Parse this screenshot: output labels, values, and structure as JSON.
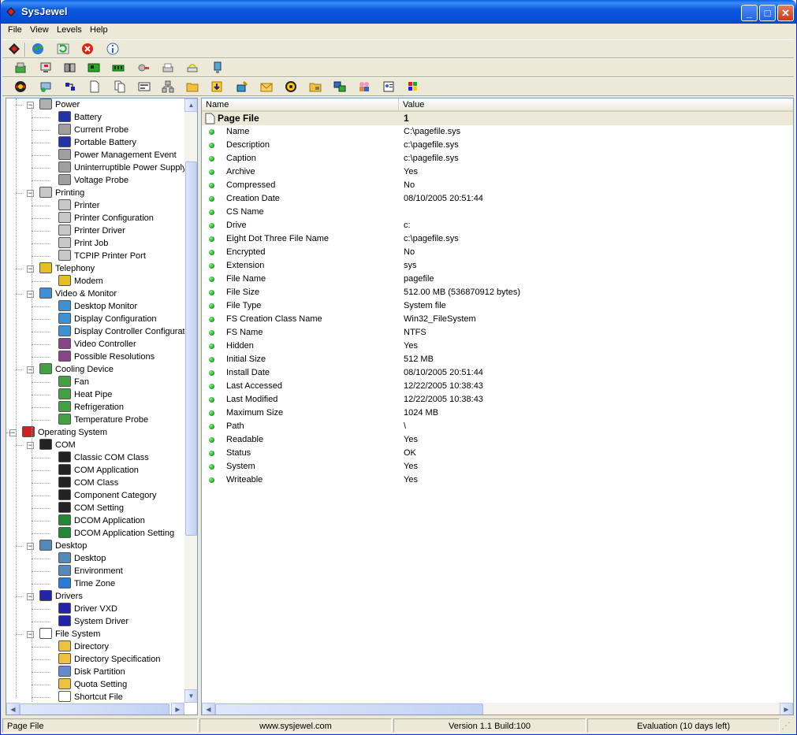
{
  "window": {
    "title": "SysJewel",
    "controls": {
      "minimize": "_",
      "maximize": "□",
      "close": "✕"
    }
  },
  "menu": [
    "File",
    "View",
    "Levels",
    "Help"
  ],
  "tree": [
    {
      "label": "Power",
      "level": 1,
      "icon": "power-icon",
      "expanded": true
    },
    {
      "label": "Battery",
      "level": 2,
      "icon": "battery-icon"
    },
    {
      "label": "Current Probe",
      "level": 2,
      "icon": "probe-icon"
    },
    {
      "label": "Portable Battery",
      "level": 2,
      "icon": "battery-icon"
    },
    {
      "label": "Power Management Event",
      "level": 2,
      "icon": "probe-icon"
    },
    {
      "label": "Uninterruptible Power Supply",
      "level": 2,
      "icon": "probe-icon"
    },
    {
      "label": "Voltage Probe",
      "level": 2,
      "icon": "probe-icon"
    },
    {
      "label": "Printing",
      "level": 1,
      "icon": "printer-icon",
      "expanded": true
    },
    {
      "label": "Printer",
      "level": 2,
      "icon": "printer-icon"
    },
    {
      "label": "Printer Configuration",
      "level": 2,
      "icon": "printer-icon"
    },
    {
      "label": "Printer Driver",
      "level": 2,
      "icon": "printer-icon"
    },
    {
      "label": "Print Job",
      "level": 2,
      "icon": "printer-icon"
    },
    {
      "label": "TCPIP Printer Port",
      "level": 2,
      "icon": "printer-icon"
    },
    {
      "label": "Telephony",
      "level": 1,
      "icon": "modem-icon",
      "expanded": true
    },
    {
      "label": "Modem",
      "level": 2,
      "icon": "modem-icon"
    },
    {
      "label": "Video & Monitor",
      "level": 1,
      "icon": "monitor-icon",
      "expanded": true
    },
    {
      "label": "Desktop Monitor",
      "level": 2,
      "icon": "monitor-icon"
    },
    {
      "label": "Display Configuration",
      "level": 2,
      "icon": "monitor-icon"
    },
    {
      "label": "Display Controller Configuratio",
      "level": 2,
      "icon": "monitor-icon"
    },
    {
      "label": "Video Controller",
      "level": 2,
      "icon": "video-card-icon"
    },
    {
      "label": "Possible Resolutions",
      "level": 2,
      "icon": "video-card-icon"
    },
    {
      "label": "Cooling Device",
      "level": 1,
      "icon": "cooling-icon",
      "expanded": true
    },
    {
      "label": "Fan",
      "level": 2,
      "icon": "cooling-icon"
    },
    {
      "label": "Heat Pipe",
      "level": 2,
      "icon": "cooling-icon"
    },
    {
      "label": "Refrigeration",
      "level": 2,
      "icon": "cooling-icon"
    },
    {
      "label": "Temperature Probe",
      "level": 2,
      "icon": "cooling-icon"
    },
    {
      "label": "Operating System",
      "level": 0,
      "icon": "windows-icon",
      "expanded": true
    },
    {
      "label": "COM",
      "level": 1,
      "icon": "com-icon",
      "expanded": true
    },
    {
      "label": "Classic COM Class",
      "level": 2,
      "icon": "com-icon"
    },
    {
      "label": "COM Application",
      "level": 2,
      "icon": "com-icon"
    },
    {
      "label": "COM Class",
      "level": 2,
      "icon": "com-icon"
    },
    {
      "label": "Component Category",
      "level": 2,
      "icon": "com-icon"
    },
    {
      "label": "COM Setting",
      "level": 2,
      "icon": "com-icon"
    },
    {
      "label": "DCOM Application",
      "level": 2,
      "icon": "dcom-icon"
    },
    {
      "label": "DCOM Application Setting",
      "level": 2,
      "icon": "dcom-icon"
    },
    {
      "label": "Desktop",
      "level": 1,
      "icon": "desktop-icon",
      "expanded": true
    },
    {
      "label": "Desktop",
      "level": 2,
      "icon": "desktop-icon"
    },
    {
      "label": "Environment",
      "level": 2,
      "icon": "desktop-icon"
    },
    {
      "label": "Time Zone",
      "level": 2,
      "icon": "globe-icon"
    },
    {
      "label": "Drivers",
      "level": 1,
      "icon": "driver-icon",
      "expanded": true
    },
    {
      "label": "Driver VXD",
      "level": 2,
      "icon": "driver-icon"
    },
    {
      "label": "System Driver",
      "level": 2,
      "icon": "driver-icon"
    },
    {
      "label": "File System",
      "level": 1,
      "icon": "file-icon",
      "expanded": true
    },
    {
      "label": "Directory",
      "level": 2,
      "icon": "folder-icon"
    },
    {
      "label": "Directory Specification",
      "level": 2,
      "icon": "folder-icon"
    },
    {
      "label": "Disk Partition",
      "level": 2,
      "icon": "disk-icon"
    },
    {
      "label": "Quota Setting",
      "level": 2,
      "icon": "folder-icon"
    },
    {
      "label": "Shortcut File",
      "level": 2,
      "icon": "file-icon"
    }
  ],
  "list": {
    "columns": [
      "Name",
      "Value"
    ],
    "header_row": {
      "name": "Page File",
      "value": "1"
    },
    "rows": [
      {
        "name": "Name",
        "value": "C:\\pagefile.sys"
      },
      {
        "name": "Description",
        "value": "c:\\pagefile.sys"
      },
      {
        "name": "Caption",
        "value": "c:\\pagefile.sys"
      },
      {
        "name": "Archive",
        "value": "Yes"
      },
      {
        "name": "Compressed",
        "value": "No"
      },
      {
        "name": "Creation Date",
        "value": "08/10/2005 20:51:44"
      },
      {
        "name": "CS Name",
        "value": ""
      },
      {
        "name": "Drive",
        "value": "c:"
      },
      {
        "name": "Eight Dot Three File Name",
        "value": "c:\\pagefile.sys"
      },
      {
        "name": "Encrypted",
        "value": "No"
      },
      {
        "name": "Extension",
        "value": "sys"
      },
      {
        "name": "File Name",
        "value": "pagefile"
      },
      {
        "name": "File Size",
        "value": "512.00 MB (536870912 bytes)"
      },
      {
        "name": "File Type",
        "value": "System file"
      },
      {
        "name": "FS Creation Class Name",
        "value": "Win32_FileSystem"
      },
      {
        "name": "FS Name",
        "value": "NTFS"
      },
      {
        "name": "Hidden",
        "value": "Yes"
      },
      {
        "name": "Initial Size",
        "value": "512 MB"
      },
      {
        "name": "Install Date",
        "value": "08/10/2005 20:51:44"
      },
      {
        "name": "Last Accessed",
        "value": "12/22/2005 10:38:43"
      },
      {
        "name": "Last Modified",
        "value": "12/22/2005 10:38:43"
      },
      {
        "name": "Maximum Size",
        "value": "1024 MB"
      },
      {
        "name": "Path",
        "value": "\\"
      },
      {
        "name": "Readable",
        "value": "Yes"
      },
      {
        "name": "Status",
        "value": "OK"
      },
      {
        "name": "System",
        "value": "Yes"
      },
      {
        "name": "Writeable",
        "value": "Yes"
      }
    ]
  },
  "status": {
    "left": "Page File",
    "url": "www.sysjewel.com",
    "version": "Version 1.1 Build:100",
    "license": "Evaluation (10 days left)"
  },
  "colors": {
    "titlebar": "#0c59de",
    "status_dot": "#1a9a1a",
    "window_bg": "#ece9d8"
  }
}
